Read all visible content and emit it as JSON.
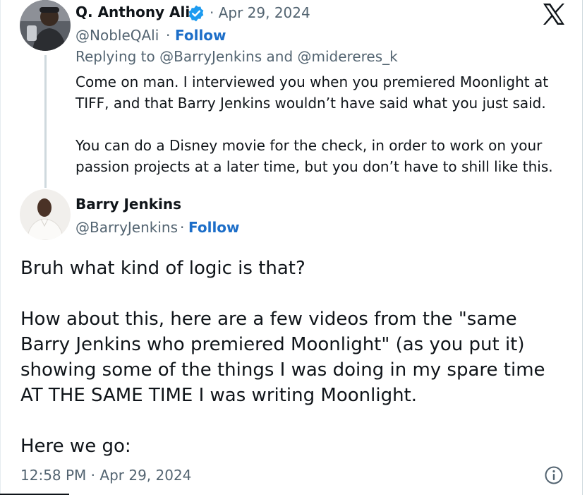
{
  "reply": {
    "author_name": "Q. Anthony Ali",
    "date": "· Apr 29, 2024",
    "handle": "@NobleQAli",
    "dot": "·",
    "follow": "Follow",
    "replying_prefix": "Replying to",
    "replying_user1": "@BarryJenkins",
    "replying_and": "and",
    "replying_user2": "@midereres_k",
    "para1_line1": "Come on man. I interviewed you when you premiered Moonlight at",
    "para1_line2": "TIFF, and that Barry Jenkins wouldn’t have said what you just said.",
    "para2_line1": "You can do a Disney movie for the check, in order to work on your",
    "para2_line2": "passion projects at a later time, but you don’t have to shill like this."
  },
  "main": {
    "author_name": "Barry Jenkins",
    "handle": "@BarryJenkins",
    "dot": "·",
    "follow": "Follow",
    "line1": "Bruh what kind of logic is that?",
    "line2": "How about this, here are a few videos from the \"same",
    "line3": "Barry Jenkins who premiered Moonlight\" (as you put it)",
    "line4": "showing some of the things I was doing in my spare time",
    "line5": "AT THE SAME TIME I was writing Moonlight.",
    "line6": "Here we go:",
    "timestamp": "12:58 PM · Apr 29, 2024"
  },
  "icons": {
    "x_logo": "x-logo-icon",
    "verified": "verified-badge-icon",
    "info": "info-icon"
  },
  "colors": {
    "follow": "#1d6ec8",
    "verified": "#1d9bf0",
    "muted": "#536471",
    "text": "#0f1419"
  }
}
